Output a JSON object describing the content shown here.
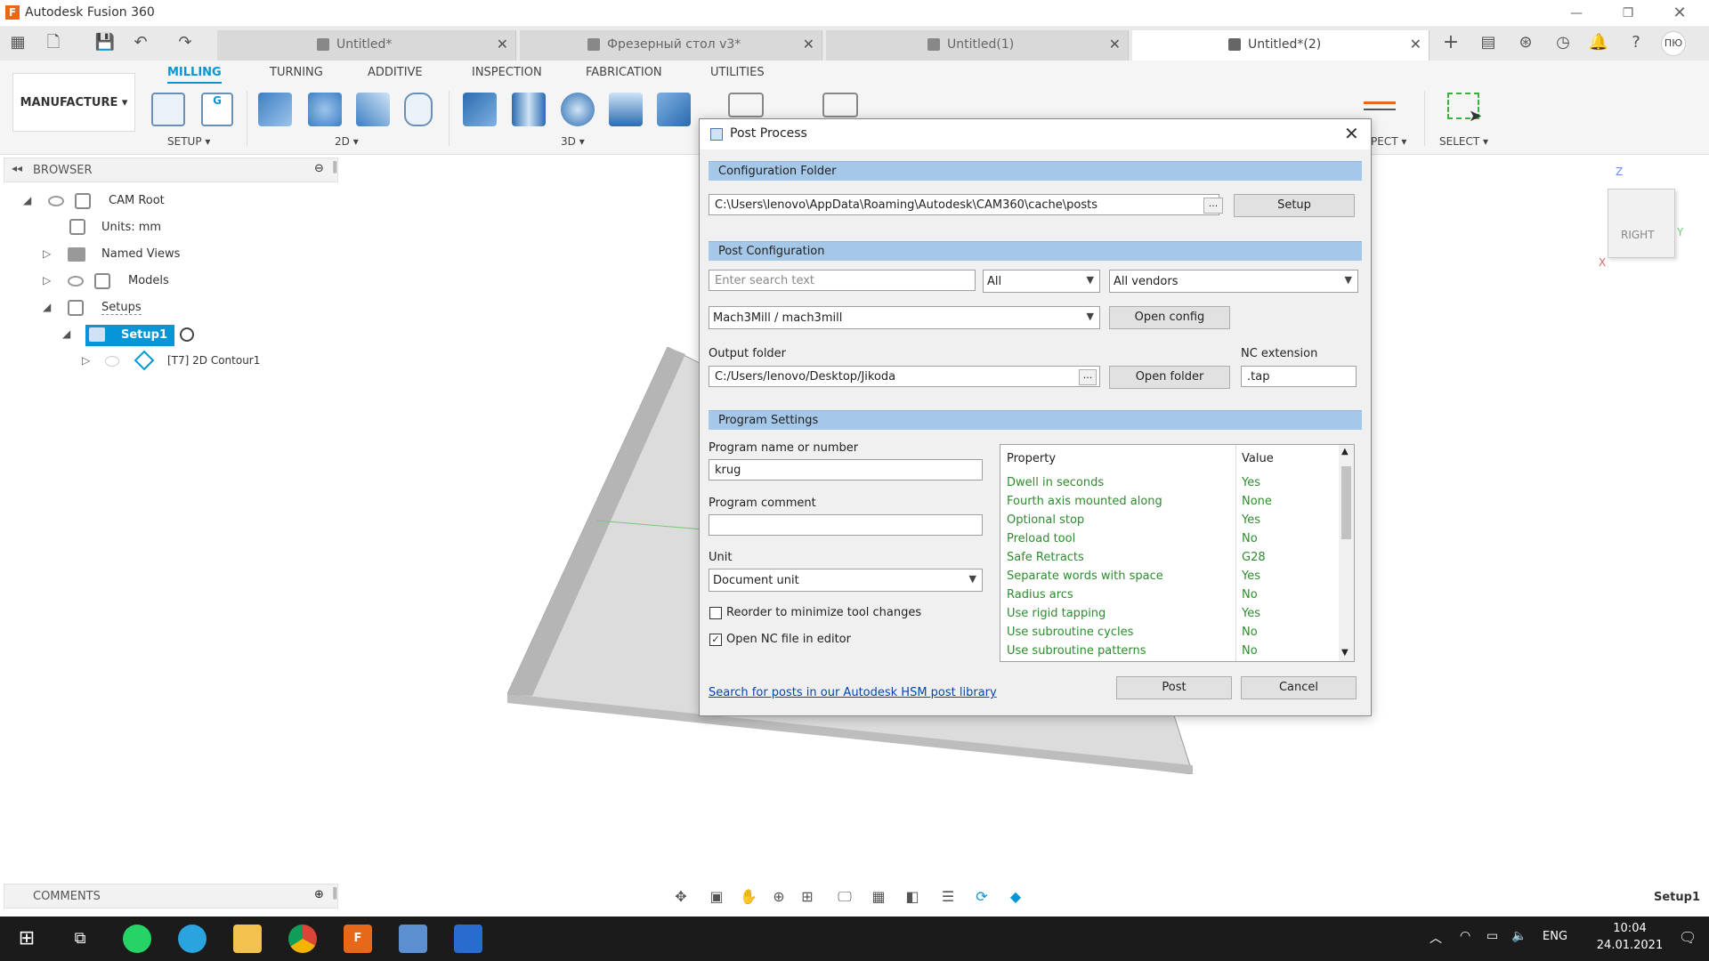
{
  "app": {
    "title": "Autodesk Fusion 360",
    "logo_letter": "F"
  },
  "tabs": [
    {
      "label": "Untitled*",
      "active": false
    },
    {
      "label": "Фрезерный стол v3*",
      "active": false
    },
    {
      "label": "Untitled(1)",
      "active": false
    },
    {
      "label": "Untitled*(2)",
      "active": true
    }
  ],
  "user_initials": "ПЮ",
  "ribbon": {
    "workspace": "MANUFACTURE",
    "tabs": [
      "MILLING",
      "TURNING",
      "ADDITIVE",
      "INSPECTION",
      "FABRICATION",
      "UTILITIES"
    ],
    "groups": {
      "setup": "SETUP",
      "twod": "2D",
      "threed": "3D",
      "inspect": "PECT",
      "select": "SELECT"
    }
  },
  "browser": {
    "title": "BROWSER",
    "items": {
      "cam_root": "CAM Root",
      "units": "Units: mm",
      "named_views": "Named Views",
      "models": "Models",
      "setups": "Setups",
      "setup1": "Setup1",
      "contour": "[T7] 2D Contour1"
    }
  },
  "viewcube": {
    "face": "RIGHT",
    "axis_z": "Z",
    "axis_y": "Y",
    "axis_x": "X"
  },
  "dialog": {
    "title": "Post Process",
    "config_folder": {
      "heading": "Configuration Folder",
      "path": "C:\\Users\\lenovo\\AppData\\Roaming\\Autodesk\\CAM360\\cache\\posts",
      "browse": "...",
      "setup_btn": "Setup"
    },
    "post_config": {
      "heading": "Post Configuration",
      "search_placeholder": "Enter search text",
      "filter": "All",
      "vendor": "All vendors",
      "post": "Mach3Mill / mach3mill",
      "open_config": "Open config",
      "output_label": "Output folder",
      "output_path": "C:/Users/lenovo/Desktop/Jikoda",
      "output_browse": "...",
      "open_folder": "Open folder",
      "nc_label": "NC extension",
      "nc_value": ".tap"
    },
    "program": {
      "heading": "Program Settings",
      "name_label": "Program name or number",
      "name_value": "krug",
      "comment_label": "Program comment",
      "comment_value": "",
      "unit_label": "Unit",
      "unit_value": "Document unit",
      "reorder_label": "Reorder to minimize tool changes",
      "reorder_checked": false,
      "open_nc_label": "Open NC file in editor",
      "open_nc_checked": true,
      "prop_header": "Property",
      "value_header": "Value",
      "properties": [
        {
          "name": "Dwell in seconds",
          "value": "Yes"
        },
        {
          "name": "Fourth axis mounted along",
          "value": "None"
        },
        {
          "name": "Optional stop",
          "value": "Yes"
        },
        {
          "name": "Preload tool",
          "value": "No"
        },
        {
          "name": "Safe Retracts",
          "value": "G28"
        },
        {
          "name": "Separate words with space",
          "value": "Yes"
        },
        {
          "name": "Radius arcs",
          "value": "No"
        },
        {
          "name": "Use rigid tapping",
          "value": "Yes"
        },
        {
          "name": "Use subroutine cycles",
          "value": "No"
        },
        {
          "name": "Use subroutine patterns",
          "value": "No"
        }
      ]
    },
    "link": "Search for posts in our Autodesk HSM post library",
    "post_btn": "Post",
    "cancel_btn": "Cancel"
  },
  "comments": {
    "title": "COMMENTS"
  },
  "status": {
    "active_setup": "Setup1"
  },
  "taskbar": {
    "lang": "ENG",
    "time": "10:04",
    "date": "24.01.2021"
  },
  "colors": {
    "accent": "#0696d7",
    "section": "#a6c8e8",
    "property_text": "#2e8b2e"
  }
}
